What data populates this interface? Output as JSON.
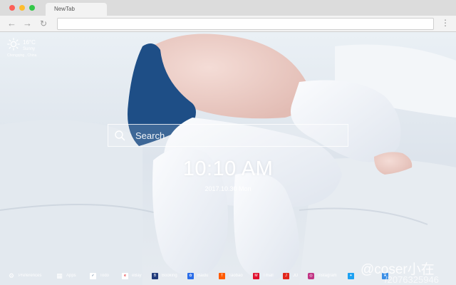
{
  "browser": {
    "tab_title": "NewTab"
  },
  "weather": {
    "temperature": "16°C",
    "condition": "Sunny",
    "location": "Chongqing , China"
  },
  "search": {
    "placeholder": "Search"
  },
  "clock": {
    "time": "10:10 AM",
    "date": "2017.10.30 Mon"
  },
  "bottom_bar": {
    "items": [
      {
        "label": "Preferences",
        "icon": "gear-icon"
      },
      {
        "label": "Apps",
        "icon": "apps-icon"
      },
      {
        "label": "Todo",
        "icon": "todo-icon"
      },
      {
        "label": "eBay",
        "icon": "ebay-icon"
      },
      {
        "label": "Booking",
        "icon": "booking-icon"
      },
      {
        "label": "Baidu",
        "icon": "baidu-icon"
      },
      {
        "label": "Taobao",
        "icon": "taobao-icon"
      },
      {
        "label": "Tmall",
        "icon": "tmall-icon"
      },
      {
        "label": "JD",
        "icon": "jd-icon"
      },
      {
        "label": "Instagram",
        "icon": "instagram-icon"
      },
      {
        "label": "",
        "icon": "twitter-icon"
      },
      {
        "label": "",
        "icon": "extra-icon"
      }
    ]
  },
  "watermark": {
    "handle": "@coser小在",
    "id": "/2076325946"
  },
  "colors": {
    "ebay": "#ffffff",
    "booking": "#1f3a7a",
    "baidu": "#2b6de8",
    "taobao": "#ff5b00",
    "tmall": "#e0102e",
    "jd": "#e1251b",
    "instagram": "#c13584",
    "twitter": "#1da1f2"
  }
}
